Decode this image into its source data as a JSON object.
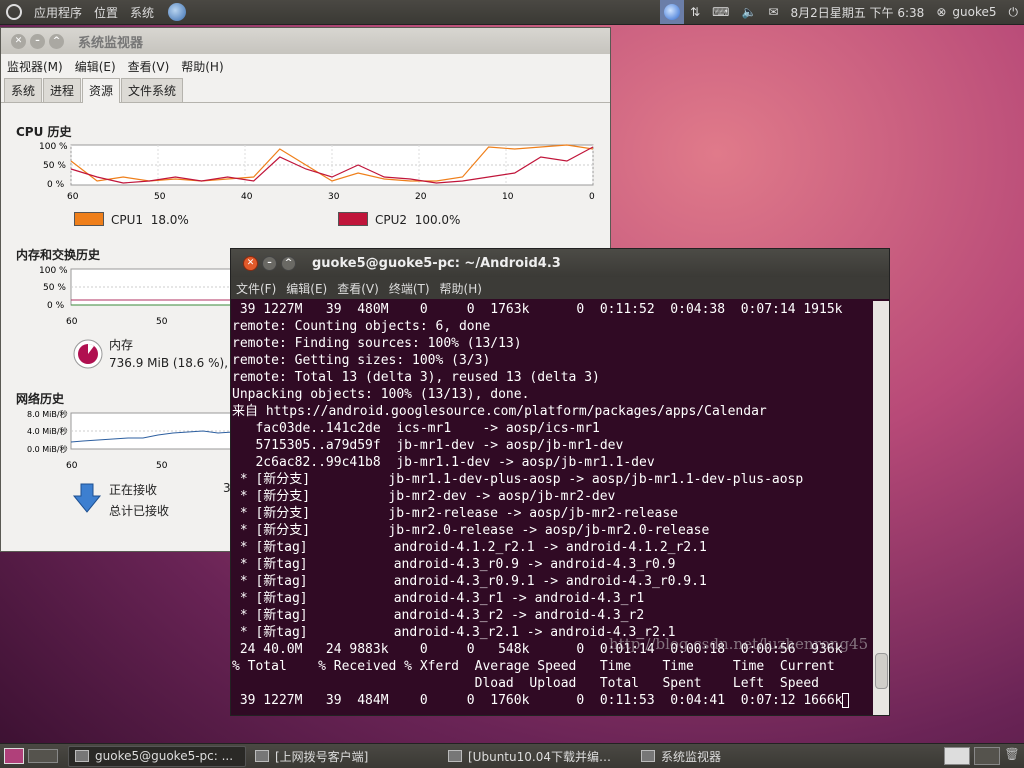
{
  "top_panel": {
    "menus": [
      "应用程序",
      "位置",
      "系统"
    ],
    "clock": "8月2日星期五 下午 6:38",
    "user": "guoke5",
    "icons": [
      "ubuntu-logo-icon",
      "browser-icon",
      "network-globe-icon",
      "transfer-arrows-icon",
      "keyboard-icon",
      "volume-icon",
      "mail-icon",
      "user-status-icon",
      "power-icon"
    ]
  },
  "sysmon": {
    "title": "系统监视器",
    "menu": [
      "监视器(M)",
      "编辑(E)",
      "查看(V)",
      "帮助(H)"
    ],
    "tabs": [
      "系统",
      "进程",
      "资源",
      "文件系统"
    ],
    "active_tab": "资源",
    "cpu": {
      "title": "CPU 历史",
      "y_ticks": [
        "100 %",
        "50 %",
        "0 %"
      ],
      "x_ticks": [
        "60",
        "50",
        "40",
        "30",
        "20",
        "10",
        "0"
      ],
      "legend": [
        {
          "label": "CPU1",
          "value": "18.0%",
          "color": "#ef7f1a"
        },
        {
          "label": "CPU2",
          "value": "100.0%",
          "color": "#c0153a"
        }
      ]
    },
    "memory": {
      "title": "内存和交换历史",
      "y_ticks": [
        "100 %",
        "50 %",
        "0 %"
      ],
      "x_ticks": [
        "60",
        "50"
      ],
      "label": "内存",
      "value": "736.9 MiB (18.6 %),"
    },
    "network": {
      "title": "网络历史",
      "y_ticks": [
        "8.0 MiB/秒",
        "4.0 MiB/秒",
        "0.0 MiB/秒"
      ],
      "x_ticks": [
        "60",
        "50"
      ],
      "receiving_label": "正在接收",
      "total_received_label": "总计已接收",
      "partial": "3"
    }
  },
  "terminal": {
    "title": "guoke5@guoke5-pc: ~/Android4.3",
    "menu": [
      "文件(F)",
      "编辑(E)",
      "查看(V)",
      "终端(T)",
      "帮助(H)"
    ],
    "lines": [
      " 39 1227M   39  480M    0     0  1763k      0  0:11:52  0:04:38  0:07:14 1915k",
      "remote: Counting objects: 6, done",
      "remote: Finding sources: 100% (13/13)",
      "remote: Getting sizes: 100% (3/3)",
      "remote: Total 13 (delta 3), reused 13 (delta 3)",
      "Unpacking objects: 100% (13/13), done.",
      "来自 https://android.googlesource.com/platform/packages/apps/Calendar",
      "   fac03de..141c2de  ics-mr1    -> aosp/ics-mr1",
      "   5715305..a79d59f  jb-mr1-dev -> aosp/jb-mr1-dev",
      "   2c6ac82..99c41b8  jb-mr1.1-dev -> aosp/jb-mr1.1-dev",
      " * [新分支]          jb-mr1.1-dev-plus-aosp -> aosp/jb-mr1.1-dev-plus-aosp",
      " * [新分支]          jb-mr2-dev -> aosp/jb-mr2-dev",
      " * [新分支]          jb-mr2-release -> aosp/jb-mr2-release",
      " * [新分支]          jb-mr2.0-release -> aosp/jb-mr2.0-release",
      " * [新tag]           android-4.1.2_r2.1 -> android-4.1.2_r2.1",
      " * [新tag]           android-4.3_r0.9 -> android-4.3_r0.9",
      " * [新tag]           android-4.3_r0.9.1 -> android-4.3_r0.9.1",
      " * [新tag]           android-4.3_r1 -> android-4.3_r1",
      " * [新tag]           android-4.3_r2 -> android-4.3_r2",
      " * [新tag]           android-4.3_r2.1 -> android-4.3_r2.1",
      " 24 40.0M   24 9883k    0     0   548k      0  0:01:14  0:00:18  0:00:56  936k",
      "% Total    % Received % Xferd  Average Speed   Time    Time     Time  Current",
      "                               Dload  Upload   Total   Spent    Left  Speed",
      " 39 1227M   39  484M    0     0  1760k      0  0:11:53  0:04:41  0:07:12 1666k"
    ],
    "watermark": "http://blog.csdn.net/luzhenrong45"
  },
  "taskbar": {
    "tasks": [
      {
        "label": "guoke5@guoke5-pc: ...",
        "active": true
      },
      {
        "label": "[上网拨号客户端]",
        "active": false
      },
      {
        "label": "[Ubuntu10.04下载并编…",
        "active": false
      },
      {
        "label": "系统监视器",
        "active": false
      }
    ]
  },
  "chart_data": [
    {
      "type": "line",
      "title": "CPU 历史",
      "x": [
        60,
        57,
        54,
        51,
        48,
        45,
        42,
        39,
        36,
        33,
        30,
        27,
        24,
        21,
        18,
        15,
        12,
        9,
        6,
        3,
        0
      ],
      "series": [
        {
          "name": "CPU1",
          "values": [
            60,
            10,
            20,
            10,
            15,
            10,
            15,
            20,
            90,
            50,
            10,
            30,
            15,
            10,
            10,
            20,
            95,
            90,
            95,
            100,
            90
          ]
        },
        {
          "name": "CPU2",
          "values": [
            40,
            20,
            5,
            10,
            20,
            10,
            20,
            10,
            70,
            40,
            20,
            50,
            20,
            15,
            5,
            10,
            20,
            30,
            70,
            60,
            95
          ]
        }
      ],
      "xlabel": "",
      "ylabel": "",
      "ylim": [
        0,
        100
      ],
      "xlim": [
        60,
        0
      ]
    }
  ]
}
